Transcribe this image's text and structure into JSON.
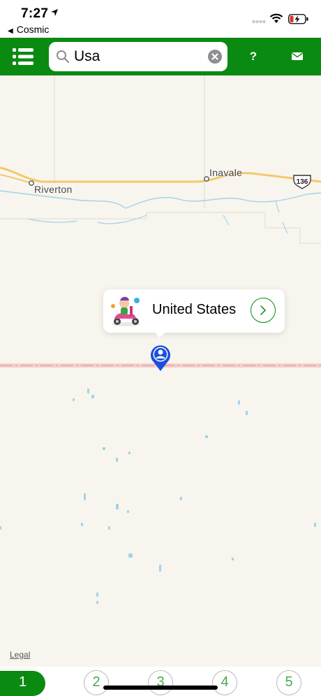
{
  "status_bar": {
    "time": "7:27",
    "back_app": "Cosmic",
    "icons": [
      "location-arrow-icon",
      "signal-icon",
      "wifi-icon",
      "battery-charging-icon"
    ]
  },
  "toolbar": {
    "menu_icon": "list-icon",
    "search": {
      "value": "Usa",
      "placeholder": ""
    },
    "help_label": "?",
    "mail_icon": "envelope-icon"
  },
  "map": {
    "places": [
      {
        "name": "Riverton"
      },
      {
        "name": "Inavale"
      }
    ],
    "route_shield": "136",
    "callout": {
      "title": "United States",
      "avatar_icon": "scooter-rider-icon",
      "detail_icon": "chevron-right-icon"
    },
    "pin_icon": "person-pin-icon",
    "legal": "Legal",
    "colors": {
      "land": "#f8f5ee",
      "road": "#f2c96b",
      "water": "#9fd3ea",
      "border": "#f1b6b6",
      "pin": "#1a4fe0"
    }
  },
  "tabbar": {
    "tabs": [
      "1",
      "2",
      "3",
      "4",
      "5"
    ],
    "active_index": 0
  },
  "colors": {
    "brand_green": "#0b8a12",
    "tab_text": "#4aa84e"
  }
}
